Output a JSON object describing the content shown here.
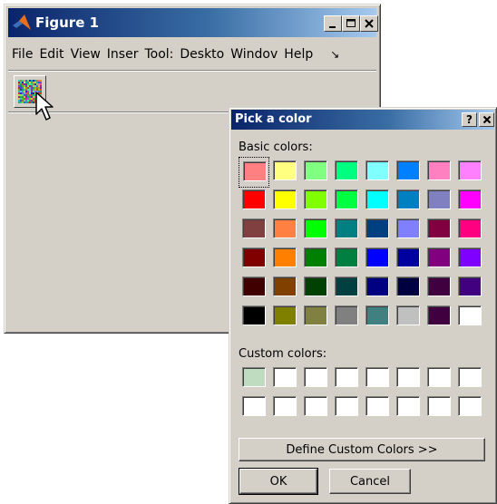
{
  "figure": {
    "title": "Figure 1",
    "controls": {
      "minimize": "_",
      "maximize": "□",
      "close": "×"
    },
    "menu": [
      "File",
      "Edit",
      "View",
      "Inser",
      "Tool:",
      "Deskto",
      "Windov",
      "Help"
    ],
    "menu_overflow": "↘",
    "toolbar": {
      "colormap_button_icon": "random-colormap-icon"
    },
    "logo_icon": "matlab-logo-icon"
  },
  "dialog": {
    "title": "Pick a color",
    "help_button": "?",
    "close_button": "×",
    "basic_label": "Basic colors:",
    "custom_label": "Custom colors:",
    "basic_colors": [
      [
        "#ff8080",
        "#ffff80",
        "#80ff80",
        "#00ff80",
        "#80ffff",
        "#0080ff",
        "#ff80c0",
        "#ff80ff"
      ],
      [
        "#ff0000",
        "#ffff00",
        "#80ff00",
        "#00ff40",
        "#00ffff",
        "#0080c0",
        "#8080c0",
        "#ff00ff"
      ],
      [
        "#804040",
        "#ff8040",
        "#00ff00",
        "#008080",
        "#004080",
        "#8080ff",
        "#800040",
        "#ff0080"
      ],
      [
        "#800000",
        "#ff8000",
        "#008000",
        "#008040",
        "#0000ff",
        "#0000a0",
        "#800080",
        "#8000ff"
      ],
      [
        "#400000",
        "#804000",
        "#004000",
        "#004040",
        "#000080",
        "#000040",
        "#400040",
        "#400080"
      ],
      [
        "#000000",
        "#808000",
        "#808040",
        "#808080",
        "#408080",
        "#c0c0c0",
        "#400040",
        "#ffffff"
      ]
    ],
    "selected_basic": {
      "row": 0,
      "col": 0
    },
    "custom_colors": [
      [
        "#c0dcc0",
        "#ffffff",
        "#ffffff",
        "#ffffff",
        "#ffffff",
        "#ffffff",
        "#ffffff",
        "#ffffff"
      ],
      [
        "#ffffff",
        "#ffffff",
        "#ffffff",
        "#ffffff",
        "#ffffff",
        "#ffffff",
        "#ffffff",
        "#ffffff"
      ]
    ],
    "define_button": "Define Custom Colors >>",
    "ok_button": "OK",
    "cancel_button": "Cancel"
  }
}
